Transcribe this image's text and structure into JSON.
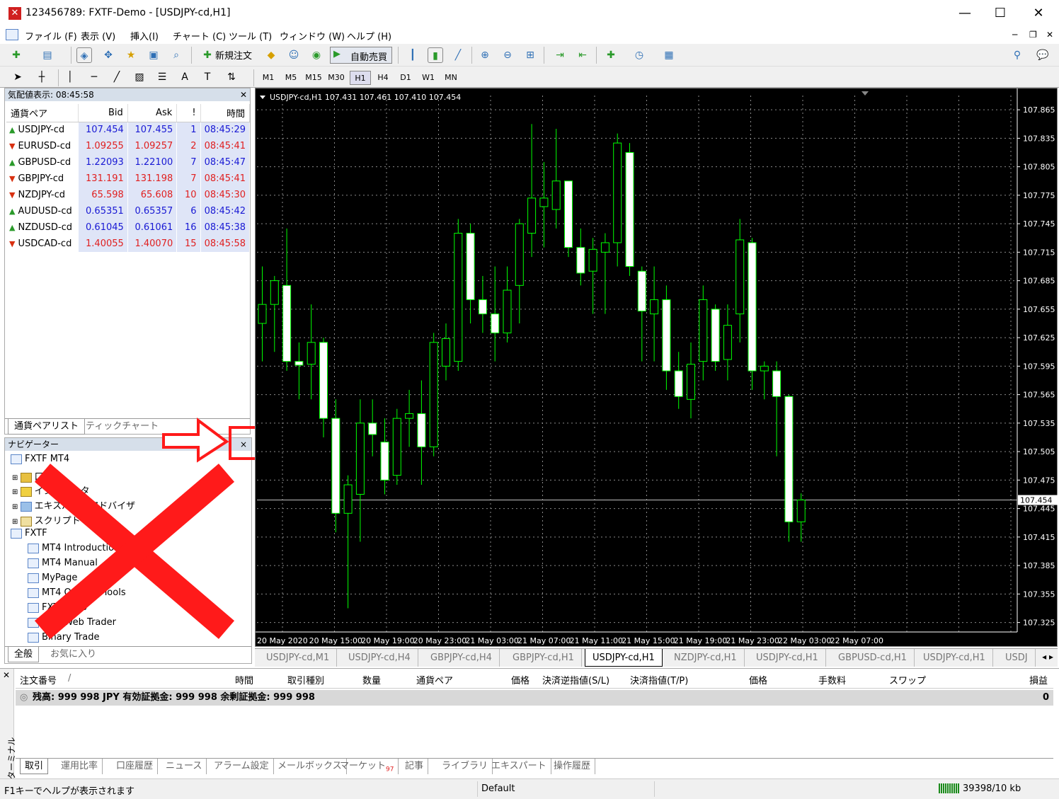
{
  "window": {
    "title": "123456789: FXTF-Demo - [USDJPY-cd,H1]",
    "min": "—",
    "max": "☐",
    "close": "✕"
  },
  "menu": [
    "ファイル (F)",
    "表示 (V)",
    "挿入(I)",
    "チャート (C)",
    "ツール (T)",
    "ウィンドウ (W)",
    "ヘルプ (H)"
  ],
  "toolbar": {
    "new_order": "新規注文",
    "auto_trade": "自動売買"
  },
  "timeframes": [
    "M1",
    "M5",
    "M15",
    "M30",
    "H1",
    "H4",
    "D1",
    "W1",
    "MN"
  ],
  "active_timeframe": "H1",
  "market_watch": {
    "title": "気配値表示: 08:45:58",
    "columns": [
      "通貨ペア",
      "Bid",
      "Ask",
      "!",
      "時間"
    ],
    "rows": [
      {
        "symbol": "USDJPY-cd",
        "bid": "107.454",
        "ask": "107.455",
        "spread": "1",
        "time": "08:45:29",
        "dir": "up"
      },
      {
        "symbol": "EURUSD-cd",
        "bid": "1.09255",
        "ask": "1.09257",
        "spread": "2",
        "time": "08:45:41",
        "dir": "down"
      },
      {
        "symbol": "GBPUSD-cd",
        "bid": "1.22093",
        "ask": "1.22100",
        "spread": "7",
        "time": "08:45:47",
        "dir": "up"
      },
      {
        "symbol": "GBPJPY-cd",
        "bid": "131.191",
        "ask": "131.198",
        "spread": "7",
        "time": "08:45:41",
        "dir": "down"
      },
      {
        "symbol": "NZDJPY-cd",
        "bid": "65.598",
        "ask": "65.608",
        "spread": "10",
        "time": "08:45:30",
        "dir": "down"
      },
      {
        "symbol": "AUDUSD-cd",
        "bid": "0.65351",
        "ask": "0.65357",
        "spread": "6",
        "time": "08:45:42",
        "dir": "up"
      },
      {
        "symbol": "NZDUSD-cd",
        "bid": "0.61045",
        "ask": "0.61061",
        "spread": "16",
        "time": "08:45:38",
        "dir": "up"
      },
      {
        "symbol": "USDCAD-cd",
        "bid": "1.40055",
        "ask": "1.40070",
        "spread": "15",
        "time": "08:45:58",
        "dir": "down"
      }
    ],
    "tabs": [
      "通貨ペアリスト",
      "ティックチャート"
    ]
  },
  "navigator": {
    "title": "ナビゲーター",
    "close": "×",
    "items": [
      "FXTF MT4",
      "口座",
      "インジケータ",
      "エキスパートアドバイザ",
      "スクリプト",
      "FXTF",
      "MT4 Introduction",
      "MT4 Manual",
      "MyPage",
      "MT4 Original Tools",
      "FXTF Web",
      "MT4 Web Trader",
      "Binary Trade"
    ],
    "tabs": [
      "全般",
      "お気に入り"
    ]
  },
  "chart": {
    "header": "USDJPY-cd,H1  107.431 107.461 107.410 107.454",
    "current_price": "107.454",
    "price_labels": [
      "107.865",
      "107.835",
      "107.805",
      "107.775",
      "107.745",
      "107.715",
      "107.685",
      "107.655",
      "107.625",
      "107.595",
      "107.565",
      "107.535",
      "107.505",
      "107.475",
      "107.445",
      "107.415",
      "107.385",
      "107.355",
      "107.325"
    ],
    "time_labels": [
      "20 May 2020",
      "20 May 15:00",
      "20 May 19:00",
      "20 May 23:00",
      "21 May 03:00",
      "21 May 07:00",
      "21 May 11:00",
      "21 May 15:00",
      "21 May 19:00",
      "21 May 23:00",
      "22 May 03:00",
      "22 May 07:00"
    ]
  },
  "chart_data": {
    "type": "candlestick",
    "ylim": [
      107.315,
      107.88
    ],
    "candles": [
      {
        "o": 107.64,
        "h": 107.7,
        "l": 107.6,
        "c": 107.66
      },
      {
        "o": 107.66,
        "h": 107.69,
        "l": 107.61,
        "c": 107.685
      },
      {
        "o": 107.68,
        "h": 107.74,
        "l": 107.59,
        "c": 107.6
      },
      {
        "o": 107.6,
        "h": 107.62,
        "l": 107.56,
        "c": 107.596
      },
      {
        "o": 107.597,
        "h": 107.66,
        "l": 107.56,
        "c": 107.62
      },
      {
        "o": 107.62,
        "h": 107.625,
        "l": 107.52,
        "c": 107.54
      },
      {
        "o": 107.54,
        "h": 107.56,
        "l": 107.42,
        "c": 107.44
      },
      {
        "o": 107.44,
        "h": 107.48,
        "l": 107.34,
        "c": 107.47
      },
      {
        "o": 107.46,
        "h": 107.56,
        "l": 107.41,
        "c": 107.535
      },
      {
        "o": 107.535,
        "h": 107.56,
        "l": 107.5,
        "c": 107.523
      },
      {
        "o": 107.515,
        "h": 107.54,
        "l": 107.46,
        "c": 107.475
      },
      {
        "o": 107.48,
        "h": 107.55,
        "l": 107.47,
        "c": 107.54
      },
      {
        "o": 107.54,
        "h": 107.57,
        "l": 107.51,
        "c": 107.545
      },
      {
        "o": 107.545,
        "h": 107.58,
        "l": 107.47,
        "c": 107.51
      },
      {
        "o": 107.51,
        "h": 107.63,
        "l": 107.5,
        "c": 107.62
      },
      {
        "o": 107.595,
        "h": 107.64,
        "l": 107.58,
        "c": 107.624
      },
      {
        "o": 107.6,
        "h": 107.75,
        "l": 107.59,
        "c": 107.735
      },
      {
        "o": 107.735,
        "h": 107.745,
        "l": 107.64,
        "c": 107.665
      },
      {
        "o": 107.665,
        "h": 107.69,
        "l": 107.63,
        "c": 107.65
      },
      {
        "o": 107.65,
        "h": 107.7,
        "l": 107.6,
        "c": 107.63
      },
      {
        "o": 107.63,
        "h": 107.7,
        "l": 107.62,
        "c": 107.675
      },
      {
        "o": 107.68,
        "h": 107.75,
        "l": 107.64,
        "c": 107.745
      },
      {
        "o": 107.735,
        "h": 107.85,
        "l": 107.71,
        "c": 107.772
      },
      {
        "o": 107.763,
        "h": 107.81,
        "l": 107.72,
        "c": 107.772
      },
      {
        "o": 107.76,
        "h": 107.845,
        "l": 107.74,
        "c": 107.79
      },
      {
        "o": 107.79,
        "h": 107.79,
        "l": 107.71,
        "c": 107.72
      },
      {
        "o": 107.72,
        "h": 107.74,
        "l": 107.68,
        "c": 107.693
      },
      {
        "o": 107.695,
        "h": 107.73,
        "l": 107.65,
        "c": 107.718
      },
      {
        "o": 107.715,
        "h": 107.735,
        "l": 107.65,
        "c": 107.725
      },
      {
        "o": 107.725,
        "h": 107.84,
        "l": 107.7,
        "c": 107.83
      },
      {
        "o": 107.82,
        "h": 107.83,
        "l": 107.69,
        "c": 107.7
      },
      {
        "o": 107.695,
        "h": 107.7,
        "l": 107.6,
        "c": 107.653
      },
      {
        "o": 107.65,
        "h": 107.7,
        "l": 107.6,
        "c": 107.665
      },
      {
        "o": 107.665,
        "h": 107.68,
        "l": 107.57,
        "c": 107.59
      },
      {
        "o": 107.59,
        "h": 107.61,
        "l": 107.55,
        "c": 107.563
      },
      {
        "o": 107.56,
        "h": 107.62,
        "l": 107.54,
        "c": 107.597
      },
      {
        "o": 107.6,
        "h": 107.68,
        "l": 107.58,
        "c": 107.665
      },
      {
        "o": 107.655,
        "h": 107.66,
        "l": 107.59,
        "c": 107.6
      },
      {
        "o": 107.602,
        "h": 107.66,
        "l": 107.58,
        "c": 107.638
      },
      {
        "o": 107.65,
        "h": 107.75,
        "l": 107.62,
        "c": 107.728
      },
      {
        "o": 107.725,
        "h": 107.73,
        "l": 107.57,
        "c": 107.59
      },
      {
        "o": 107.59,
        "h": 107.6,
        "l": 107.56,
        "c": 107.595
      },
      {
        "o": 107.59,
        "h": 107.6,
        "l": 107.5,
        "c": 107.563
      },
      {
        "o": 107.563,
        "h": 107.565,
        "l": 107.41,
        "c": 107.431
      },
      {
        "o": 107.431,
        "h": 107.461,
        "l": 107.41,
        "c": 107.454
      }
    ]
  },
  "chart_tabs": [
    "USDJPY-cd,M1",
    "USDJPY-cd,H4",
    "GBPJPY-cd,H4",
    "GBPJPY-cd,H1",
    "USDJPY-cd,H1",
    "NZDJPY-cd,H1",
    "USDJPY-cd,H1",
    "GBPUSD-cd,H1",
    "USDJPY-cd,H1",
    "USDJ"
  ],
  "active_chart_tab": 4,
  "terminal": {
    "columns": [
      "注文番号",
      "/",
      "時間",
      "取引種別",
      "数量",
      "通貨ペア",
      "価格",
      "決済逆指値(S/L)",
      "決済指値(T/P)",
      "価格",
      "手数料",
      "スワップ",
      "損益"
    ],
    "balance": "残高: 999 998 JPY  有効証拠金: 999 998  余剰証拠金: 999 998",
    "balance_profit": "0",
    "side_label": "ターミナル",
    "tabs": [
      "取引",
      "運用比率",
      "口座履歴",
      "ニュース",
      "アラーム設定",
      "メールボックス",
      "マーケット",
      "記事",
      "ライブラリ",
      "エキスパート",
      "操作履歴"
    ],
    "market_badge": "97"
  },
  "status": {
    "help": "F1キーでヘルプが表示されます",
    "profile": "Default",
    "traffic": "39398/10 kb"
  },
  "colors": {
    "bull": "#00ff00",
    "bear": "#ffffff",
    "annotation_red": "#ff1a1a"
  }
}
